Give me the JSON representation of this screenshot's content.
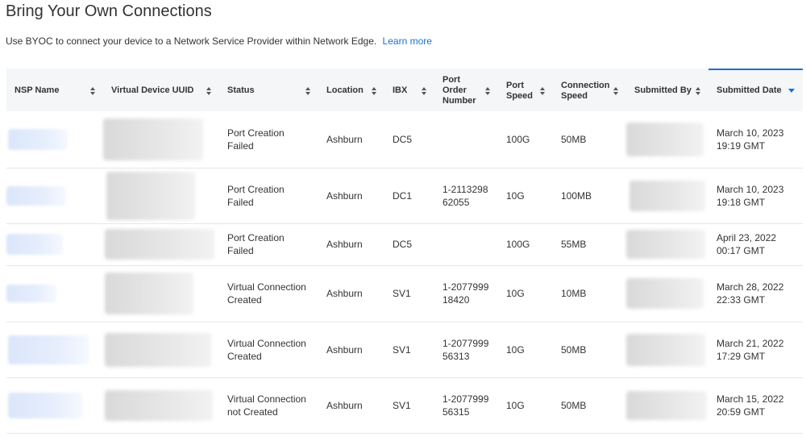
{
  "header": {
    "title": "Bring Your Own Connections",
    "description": "Use BYOC to connect your device to a Network Service Provider within Network Edge.",
    "learn_more": "Learn more"
  },
  "table": {
    "columns": [
      {
        "label": "NSP Name"
      },
      {
        "label": "Virtual Device UUID"
      },
      {
        "label": "Status"
      },
      {
        "label": "Location"
      },
      {
        "label": "IBX"
      },
      {
        "label": "Port Order Number"
      },
      {
        "label": "Port Speed"
      },
      {
        "label": "Connection Speed"
      },
      {
        "label": "Submitted By"
      },
      {
        "label": "Submitted Date"
      }
    ],
    "sorted_column": "Submitted Date",
    "rows": [
      {
        "status": "Port Creation Failed",
        "location": "Ashburn",
        "ibx": "DC5",
        "port_order": "",
        "port_speed": "100G",
        "conn_speed": "50MB",
        "date": "March 10, 2023",
        "time": "19:19 GMT"
      },
      {
        "status": "Port Creation Failed",
        "location": "Ashburn",
        "ibx": "DC1",
        "port_order": "1-211329862055",
        "port_speed": "10G",
        "conn_speed": "100MB",
        "date": "March 10, 2023",
        "time": "19:18 GMT"
      },
      {
        "status": "Port Creation Failed",
        "location": "Ashburn",
        "ibx": "DC5",
        "port_order": "",
        "port_speed": "100G",
        "conn_speed": "55MB",
        "date": "April 23, 2022",
        "time": "00:17 GMT"
      },
      {
        "status": "Virtual Connection Created",
        "location": "Ashburn",
        "ibx": "SV1",
        "port_order": "1-207799918420",
        "port_speed": "10G",
        "conn_speed": "10MB",
        "date": "March 28, 2022",
        "time": "22:33 GMT"
      },
      {
        "status": "Virtual Connection Created",
        "location": "Ashburn",
        "ibx": "SV1",
        "port_order": "1-207799956313",
        "port_speed": "10G",
        "conn_speed": "50MB",
        "date": "March 21, 2022",
        "time": "17:29 GMT"
      },
      {
        "status": "Virtual Connection not Created",
        "location": "Ashburn",
        "ibx": "SV1",
        "port_order": "1-207799956315",
        "port_speed": "10G",
        "conn_speed": "50MB",
        "date": "March 15, 2022",
        "time": "20:59 GMT"
      }
    ]
  }
}
